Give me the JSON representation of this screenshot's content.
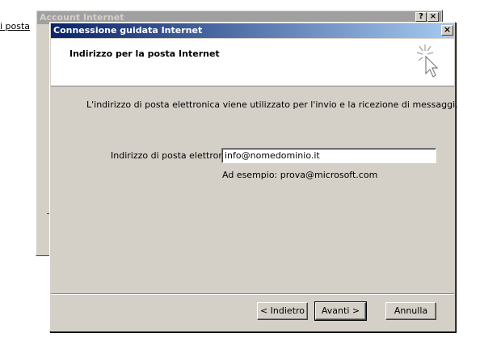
{
  "background": {
    "link_text": "i posta",
    "window_title": "Account Internet",
    "help_button": "?",
    "close_button": "×"
  },
  "dialog": {
    "title": "Connessione guidata Internet",
    "close_button": "×",
    "header_title": "Indirizzo per la posta Internet",
    "description": "L'indirizzo di posta elettronica viene utilizzato per l'invio e la ricezione di messaggi.",
    "email_label": "Indirizzo di posta elettronica:",
    "email_value": "info@nomedominio.it",
    "example": "Ad esempio: prova@microsoft.com",
    "buttons": {
      "back": "< Indietro",
      "next": "Avanti >",
      "cancel": "Annulla"
    }
  },
  "colors": {
    "title_active_start": "#0a246a",
    "title_active_end": "#a6caf0",
    "title_inactive": "#a0a0a0",
    "face": "#d4d0c8"
  },
  "icons": {
    "wizard": "sparkle-cursor-icon"
  }
}
